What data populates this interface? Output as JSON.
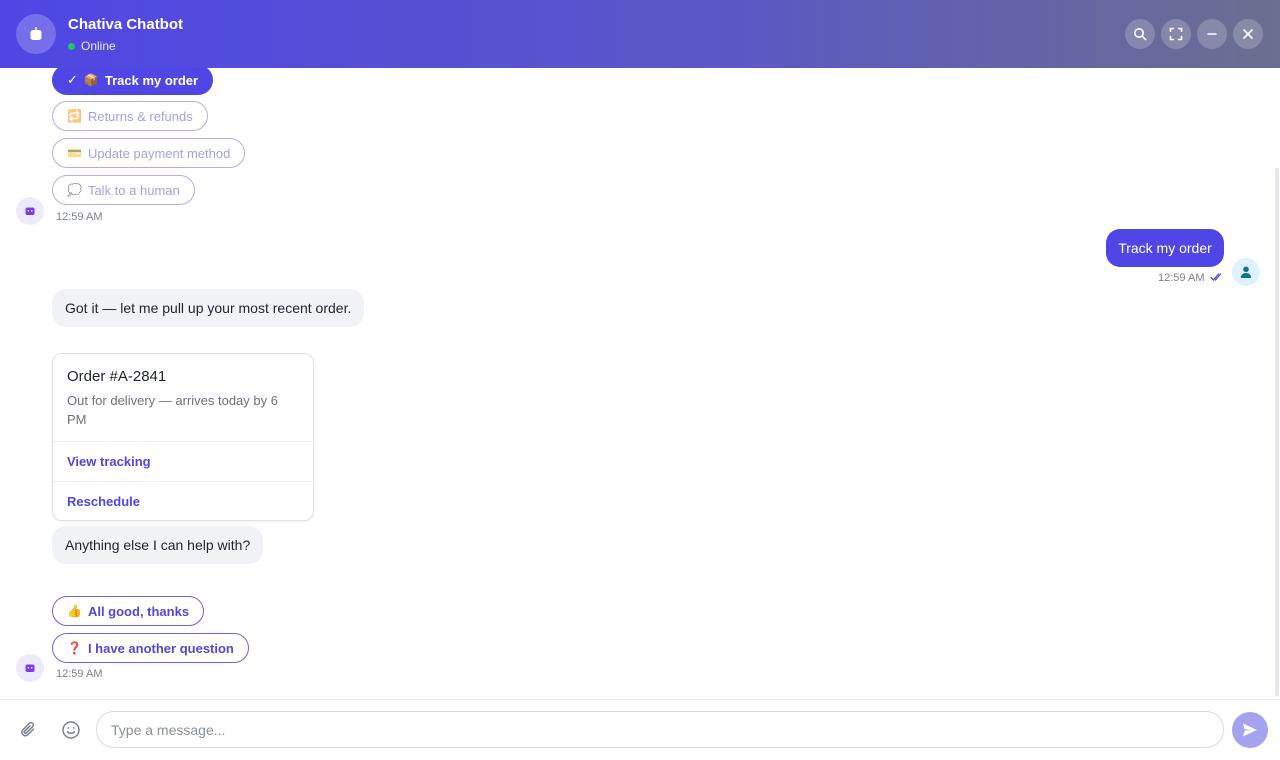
{
  "header": {
    "title": "Chativa Chatbot",
    "status": "Online",
    "actions": [
      "search-icon",
      "fullscreen-icon",
      "minimize-icon",
      "close-icon"
    ]
  },
  "messages": {
    "quick_replies_1": [
      {
        "emoji": "📦",
        "label": "Track my order",
        "selected": true,
        "check": "✓"
      },
      {
        "emoji": "🔁",
        "label": "Returns & refunds",
        "selected": false
      },
      {
        "emoji": "💳",
        "label": "Update payment method",
        "selected": false
      },
      {
        "emoji": "💭",
        "label": "Talk to a human",
        "selected": false
      }
    ],
    "ts_1": "12:59 AM",
    "user_msg": "Track my order",
    "user_ts": "12:59 AM",
    "bot_msg_1": "Got it — let me pull up your most recent order.",
    "card": {
      "title": "Order #A-2841",
      "subtitle": "Out for delivery — arrives today by 6 PM",
      "actions": [
        "View tracking",
        "Reschedule"
      ]
    },
    "bot_msg_2": "Anything else I can help with?",
    "quick_replies_2": [
      {
        "emoji": "👍",
        "label": "All good, thanks"
      },
      {
        "emoji": "❓",
        "label": "I have another question"
      }
    ],
    "ts_2": "12:59 AM"
  },
  "composer": {
    "placeholder": "Type a message...",
    "icons": [
      "paperclip-icon",
      "emoji-icon",
      "send-icon"
    ]
  },
  "colors": {
    "accent": "#4f46e5",
    "online": "#22c55e"
  }
}
